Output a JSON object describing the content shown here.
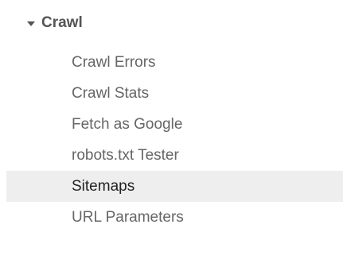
{
  "nav": {
    "section": {
      "title": "Crawl",
      "expanded": true,
      "caret_icon": "caret-down-icon"
    },
    "items": [
      {
        "label": "Crawl Errors",
        "active": false
      },
      {
        "label": "Crawl Stats",
        "active": false
      },
      {
        "label": "Fetch as Google",
        "active": false
      },
      {
        "label": "robots.txt Tester",
        "active": false
      },
      {
        "label": "Sitemaps",
        "active": true
      },
      {
        "label": "URL Parameters",
        "active": false
      }
    ],
    "colors": {
      "text": "#666666",
      "header_text": "#555555",
      "active_bg": "#eeeeee",
      "active_text": "#222222"
    }
  }
}
